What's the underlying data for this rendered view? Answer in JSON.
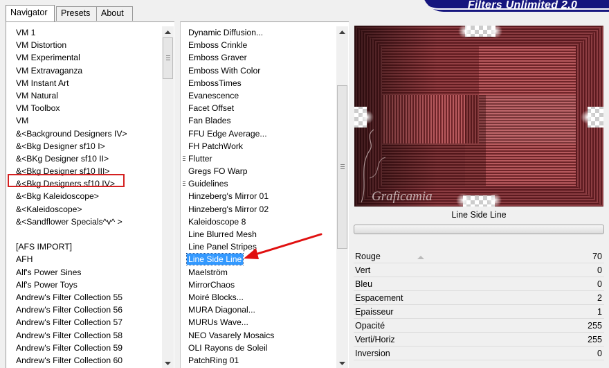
{
  "tabs": [
    {
      "label": "Navigator",
      "active": true
    },
    {
      "label": "Presets",
      "active": false
    },
    {
      "label": "About",
      "active": false
    }
  ],
  "brand": {
    "title": "Filters Unlimited 2.0"
  },
  "categories": [
    {
      "label": "VM 1"
    },
    {
      "label": "VM Distortion"
    },
    {
      "label": "VM Experimental"
    },
    {
      "label": "VM Extravaganza"
    },
    {
      "label": "VM Instant Art"
    },
    {
      "label": "VM Natural"
    },
    {
      "label": "VM Toolbox"
    },
    {
      "label": "VM"
    },
    {
      "label": "&<Background Designers IV>"
    },
    {
      "label": "&<Bkg Designer sf10 I>"
    },
    {
      "label": "&<BKg Designer sf10 II>",
      "highlighted": true
    },
    {
      "label": "&<Bkg Designer sf10 III>"
    },
    {
      "label": "&<Bkg Designers sf10 IV>"
    },
    {
      "label": "&<Bkg Kaleidoscope>"
    },
    {
      "label": "&<Kaleidoscope>"
    },
    {
      "label": "&<Sandflower Specials^v^ >"
    },
    {
      "label": ""
    },
    {
      "label": "[AFS IMPORT]"
    },
    {
      "label": "AFH"
    },
    {
      "label": "Alf's Power Sines"
    },
    {
      "label": "Alf's Power Toys"
    },
    {
      "label": "Andrew's Filter Collection 55"
    },
    {
      "label": "Andrew's Filter Collection 56"
    },
    {
      "label": "Andrew's Filter Collection 57"
    },
    {
      "label": "Andrew's Filter Collection 58"
    },
    {
      "label": "Andrew's Filter Collection 59"
    },
    {
      "label": "Andrew's Filter Collection 60"
    }
  ],
  "filters": [
    {
      "label": "Dynamic Diffusion..."
    },
    {
      "label": "Emboss Crinkle"
    },
    {
      "label": "Emboss Graver"
    },
    {
      "label": "Emboss With Color"
    },
    {
      "label": "EmbossTimes"
    },
    {
      "label": "Evanescence"
    },
    {
      "label": "Facet Offset"
    },
    {
      "label": "Fan Blades"
    },
    {
      "label": "FFU Edge Average..."
    },
    {
      "label": "FH PatchWork"
    },
    {
      "label": "Flutter",
      "group": true
    },
    {
      "label": "Gregs FO Warp"
    },
    {
      "label": "Guidelines",
      "group": true
    },
    {
      "label": "Hinzeberg's Mirror 01"
    },
    {
      "label": "Hinzeberg's Mirror 02"
    },
    {
      "label": "Kaleidoscope 8"
    },
    {
      "label": "Line Blurred Mesh"
    },
    {
      "label": "Line Panel Stripes"
    },
    {
      "label": "Line Side Line",
      "selected": true
    },
    {
      "label": "Maelström"
    },
    {
      "label": "MirrorChaos"
    },
    {
      "label": "Moiré Blocks..."
    },
    {
      "label": "MURA Diagonal..."
    },
    {
      "label": "MURUs Wave..."
    },
    {
      "label": "NEO Vasarely Mosaics"
    },
    {
      "label": "OLI Rayons de Soleil"
    },
    {
      "label": "PatchRing 01"
    }
  ],
  "preview": {
    "filter_name": "Line Side Line",
    "watermark": "Graficamia"
  },
  "params": [
    {
      "name": "Rouge",
      "value": "70"
    },
    {
      "name": "Vert",
      "value": "0"
    },
    {
      "name": "Bleu",
      "value": "0"
    },
    {
      "name": "Espacement",
      "value": "2"
    },
    {
      "name": "Epaisseur",
      "value": "1"
    },
    {
      "name": "Opacité",
      "value": "255"
    },
    {
      "name": "Verti/Horiz",
      "value": "255"
    },
    {
      "name": "Inversion",
      "value": "0"
    }
  ],
  "colors": {
    "selection": "#3399ff",
    "highlight_box": "#d42020",
    "annotation_arrow": "#e01010",
    "brand_bg": "#16167e"
  }
}
